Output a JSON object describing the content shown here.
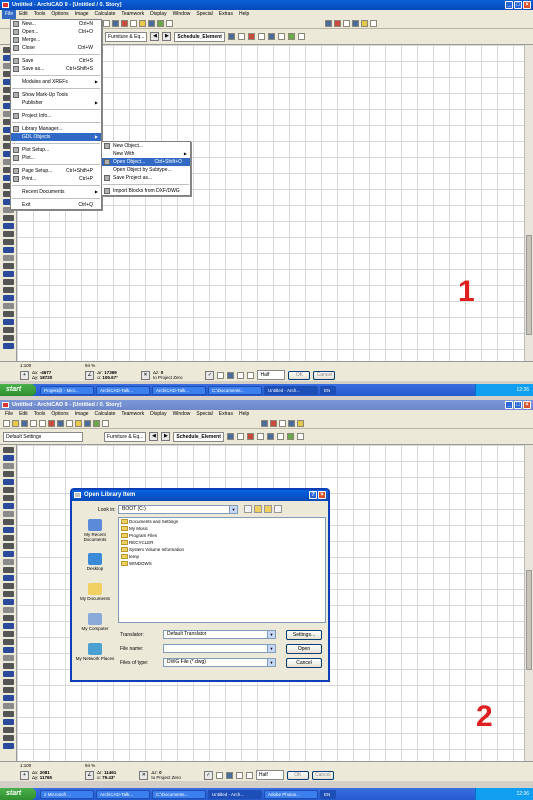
{
  "shot1": {
    "window_title": "Untitled - ArchiCAD 9 - [Untitled / 0. Story]",
    "menus": [
      "File",
      "Edit",
      "Tools",
      "Options",
      "Image",
      "Calculate",
      "Teamwork",
      "Display",
      "Window",
      "Special",
      "Extras",
      "Help"
    ],
    "active_menu": "File",
    "infobox": {
      "library": "Furniture & Eq...",
      "schedule": "Schedule_Element"
    },
    "file_menu": [
      {
        "label": "New...",
        "shortcut": "Ctrl+N"
      },
      {
        "label": "Open...",
        "shortcut": "Ctrl+O"
      },
      {
        "label": "Merge...",
        "shortcut": ""
      },
      {
        "label": "Close",
        "shortcut": "Ctrl+W"
      },
      {
        "label": "Save",
        "shortcut": "Ctrl+S"
      },
      {
        "label": "Save as...",
        "shortcut": "Ctrl+Shift+S"
      },
      {
        "label": "Modules and XREFs",
        "shortcut": ""
      },
      {
        "label": "Show Mark-Up Tools",
        "shortcut": ""
      },
      {
        "label": "Publisher",
        "shortcut": ""
      },
      {
        "label": "Project Info...",
        "shortcut": ""
      },
      {
        "label": "Library Manager...",
        "shortcut": ""
      },
      {
        "label": "GDL Objects",
        "shortcut": ""
      },
      {
        "label": "Plot Setup...",
        "shortcut": ""
      },
      {
        "label": "Plot...",
        "shortcut": ""
      },
      {
        "label": "Page Setup...",
        "shortcut": "Ctrl+Shift+P"
      },
      {
        "label": "Print...",
        "shortcut": "Ctrl+P"
      },
      {
        "label": "Recent Documents",
        "shortcut": ""
      },
      {
        "label": "Exit",
        "shortcut": "Ctrl+Q"
      }
    ],
    "gdl_submenu": [
      {
        "label": "New Object...",
        "shortcut": ""
      },
      {
        "label": "New With",
        "shortcut": ""
      },
      {
        "label": "Open Object...",
        "shortcut": "Ctrl+Shift+O"
      },
      {
        "label": "Open Object by Subtype...",
        "shortcut": ""
      },
      {
        "label": "Save Project as...",
        "shortcut": ""
      },
      {
        "label": "Import Blocks from DXF/DWG",
        "shortcut": ""
      }
    ],
    "zoom_scale": "1:100",
    "zoom_percent": "94 %",
    "coords": {
      "dx": "-4677",
      "dy": "18720",
      "ax": "17369",
      "ay": "105.67°",
      "z": "0",
      "ref": "to Project Zero"
    },
    "layer": "Half",
    "ok": "OK",
    "cancel": "Cancel",
    "label_number": "1"
  },
  "shot2": {
    "window_title": "Untitled - ArchiCAD 9 - [Untitled / 0. Story]",
    "menus": [
      "File",
      "Edit",
      "Tools",
      "Options",
      "Image",
      "Calculate",
      "Teamwork",
      "Display",
      "Window",
      "Special",
      "Extras",
      "Help"
    ],
    "infobox": {
      "settings": "Default Settings",
      "library": "Furniture & Eq...",
      "schedule": "Schedule_Element"
    },
    "zoom_scale": "1:100",
    "zoom_percent": "94 %",
    "coords": {
      "dx": "2081",
      "dy": "11765",
      "ax": "11461",
      "ay": "79.43°",
      "z": "0",
      "ref": "to Project Zero"
    },
    "layer": "Half",
    "ok": "OK",
    "cancel": "Cancel",
    "label_number": "2"
  },
  "dialog": {
    "title": "Open Library Item",
    "look_in_label": "Look in:",
    "look_in_value": "BOOT (C:)",
    "places": [
      "My Recent Documents",
      "Desktop",
      "My Documents",
      "My Computer",
      "My Network Places"
    ],
    "files": [
      "Documents and Settings",
      "My Music",
      "Program Files",
      "RECYCLER",
      "System Volume Information",
      "temp",
      "WINDOWS"
    ],
    "translator_label": "Translator:",
    "translator_value": "Default Translator",
    "settings_btn": "Settings...",
    "filename_label": "File name:",
    "filename_value": "",
    "filetype_label": "Files of type:",
    "filetype_value": "DWG File (*.dwg)",
    "open_btn": "Open",
    "cancel_btn": "Cancel"
  },
  "taskbar1": {
    "start": "start",
    "tasks": [
      "Projekt@ - Micr...",
      "ArchiCAD-Talk...",
      "ArchiCAD-Talk...",
      "C:\\Documents...",
      "Untitled - Arch..."
    ],
    "lang": "EN",
    "clock": "12:36"
  },
  "taskbar2": {
    "start": "start",
    "tasks": [
      "2 Microsoft ...",
      "ArchiCAD-Talk...",
      "C:\\Documents...",
      "Untitled - Arch...",
      "Adobe Photos..."
    ],
    "lang": "EN",
    "clock": "12:36"
  }
}
